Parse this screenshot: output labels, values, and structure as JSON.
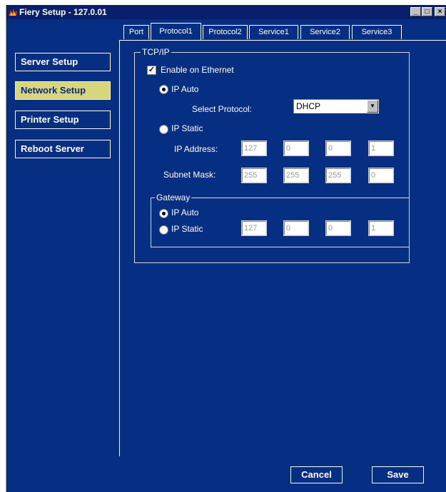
{
  "window": {
    "title": "Fiery Setup - 127.0.01",
    "minimize_glyph": "_",
    "maximize_glyph": "□",
    "close_glyph": "×"
  },
  "sidebar": {
    "items": [
      {
        "label": "Server Setup",
        "active": false
      },
      {
        "label": "Network Setup",
        "active": true
      },
      {
        "label": "Printer Setup",
        "active": false
      },
      {
        "label": "Reboot Server",
        "active": false
      }
    ]
  },
  "tabs": [
    {
      "label": "Port",
      "active": false
    },
    {
      "label": "Protocol1",
      "active": true
    },
    {
      "label": "Protocol2",
      "active": false
    },
    {
      "label": "Service1",
      "active": false
    },
    {
      "label": "Service2",
      "active": false
    },
    {
      "label": "Service3",
      "active": false
    }
  ],
  "tcpip": {
    "legend": "TCP/IP",
    "enable_label": "Enable on Ethernet",
    "enable_checked": true,
    "ip_auto_label": "IP Auto",
    "ip_auto_selected": true,
    "select_protocol_label": "Select Protocol:",
    "select_protocol_value": "DHCP",
    "ip_static_label": "IP Static",
    "ip_static_selected": false,
    "ip_address_label": "IP Address:",
    "ip_address": [
      "127",
      "0",
      "0",
      "1"
    ],
    "subnet_mask_label": "Subnet Mask:",
    "subnet_mask": [
      "255",
      "255",
      "255",
      "0"
    ]
  },
  "gateway": {
    "legend": "Gateway",
    "ip_auto_label": "IP Auto",
    "ip_auto_selected": true,
    "ip_static_label": "IP Static",
    "ip_static_selected": false,
    "address": [
      "127",
      "0",
      "0",
      "1"
    ]
  },
  "buttons": {
    "cancel_label": "Cancel",
    "save_label": "Save"
  },
  "colors": {
    "background": "#062e82",
    "active_nav": "#d7d67c",
    "titlebar": "#0a1f6b"
  }
}
